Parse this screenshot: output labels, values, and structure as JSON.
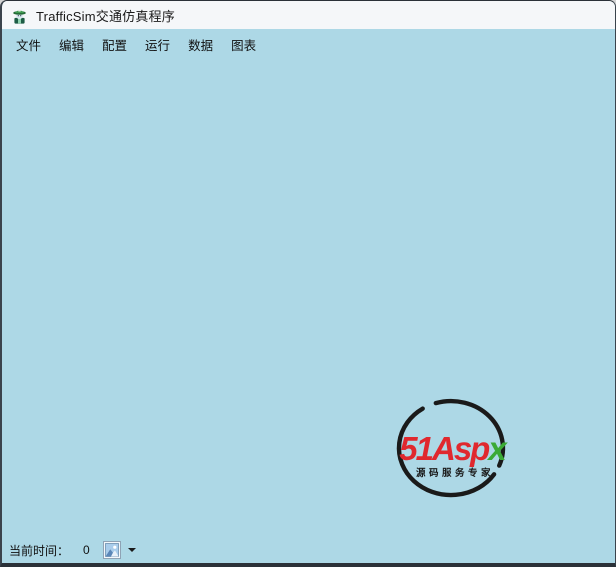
{
  "window": {
    "title": "TrafficSim交通仿真程序"
  },
  "menu": {
    "items": [
      {
        "label": "文件"
      },
      {
        "label": "编辑"
      },
      {
        "label": "配置"
      },
      {
        "label": "运行"
      },
      {
        "label": "数据"
      },
      {
        "label": "图表"
      }
    ]
  },
  "client": {
    "watermark": {
      "part_51": "51",
      "part_asp": "Asp",
      "part_x": "x",
      "subtitle": "源码服务专家",
      "color_red": "#e0282e",
      "color_green": "#3aaa35",
      "color_ring": "#1a1a1a"
    }
  },
  "statusbar": {
    "time_label": "当前时间：",
    "time_value": "0"
  },
  "icons": {
    "app_icon": "traffic-officer",
    "status_image_icon": "picture-thumbnail",
    "status_dropdown_icon": "▼"
  },
  "colors": {
    "client_bg": "#add8e6",
    "titlebar_bg": "#f5f7f9",
    "window_border": "#3a434c"
  }
}
